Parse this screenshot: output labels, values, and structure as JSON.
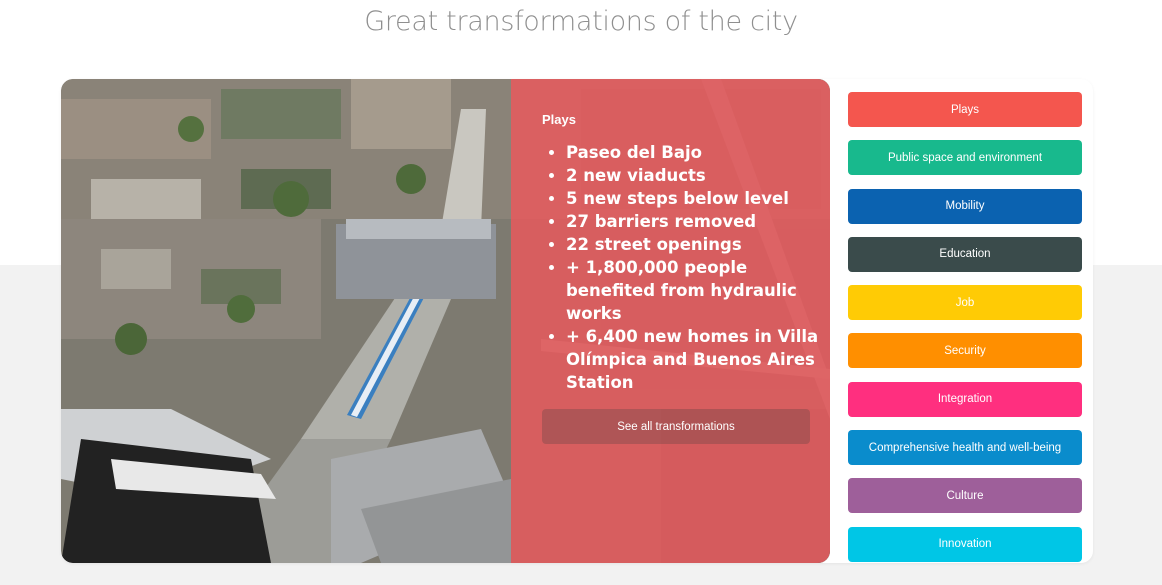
{
  "page": {
    "title": "Great transformations of the city"
  },
  "highlight": {
    "heading": "Plays",
    "items": [
      "Paseo del Bajo",
      "2 new viaducts",
      "5 new steps below level",
      "27 barriers removed",
      "22 street openings",
      "+ 1,800,000 people benefited from hydraulic works",
      "+ 6,400 new homes in Villa Olímpica and Buenos Aires Station"
    ],
    "button_label": "See all transformations",
    "overlay_color": "#ec585c"
  },
  "categories": [
    {
      "label": "Plays",
      "color": "#f4564e"
    },
    {
      "label": "Public space and environment",
      "color": "#18b98d"
    },
    {
      "label": "Mobility",
      "color": "#0b62b0"
    },
    {
      "label": "Education",
      "color": "#3a4b4b"
    },
    {
      "label": "Job",
      "color": "#ffcb05"
    },
    {
      "label": "Security",
      "color": "#ff8f00"
    },
    {
      "label": "Integration",
      "color": "#ff2f7f"
    },
    {
      "label": "Comprehensive health and well-being",
      "color": "#0a8ccc"
    },
    {
      "label": "Culture",
      "color": "#9e5f9a"
    },
    {
      "label": "Innovation",
      "color": "#00c6e6"
    }
  ]
}
